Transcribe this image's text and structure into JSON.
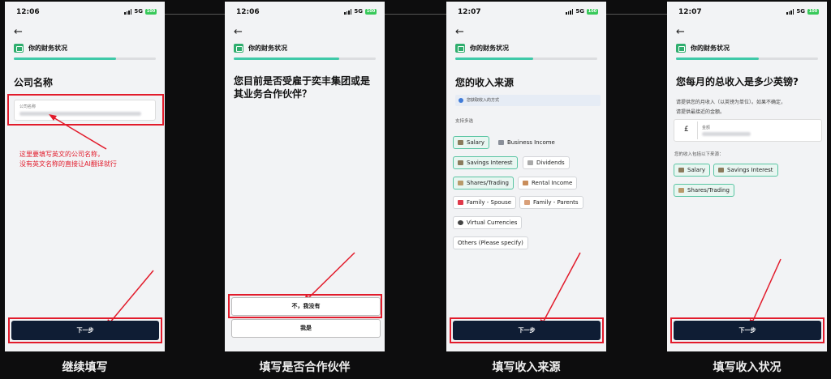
{
  "status_bar": {
    "times": [
      "12:06",
      "12:06",
      "12:07",
      "12:07"
    ],
    "network": "5G",
    "battery": "100"
  },
  "screens": [
    {
      "header": "你的财务状况",
      "question": "公司名称",
      "field_label": "公司名称",
      "annotation": [
        "这里要填写英文的公司名称，",
        "没有英文名称的直接让AI翻译就行"
      ],
      "next_button": "下一步"
    },
    {
      "header": "你的财务状况",
      "question": [
        "您目前是否受雇于奕丰集团或是",
        "其业务合作伙伴？"
      ],
      "options": [
        "不，我没有",
        "我是"
      ]
    },
    {
      "header": "你的财务状况",
      "question": "您的收入来源",
      "info": "您获取收入的方式",
      "multi_hint": "支持多选",
      "sources": [
        {
          "label": "Salary",
          "selected": true,
          "icon": "briefcase-icon"
        },
        {
          "label": "Business Income",
          "selected": false,
          "icon": "building-icon"
        },
        {
          "label": "Savings Interest",
          "selected": true,
          "icon": "bank-icon"
        },
        {
          "label": "Dividends",
          "selected": false,
          "icon": "split-icon"
        },
        {
          "label": "Shares/Trading",
          "selected": true,
          "icon": "chart-icon"
        },
        {
          "label": "Rental Income",
          "selected": false,
          "icon": "house-icon"
        },
        {
          "label": "Family - Spouse",
          "selected": false,
          "icon": "heart-icon"
        },
        {
          "label": "Family - Parents",
          "selected": false,
          "icon": "family-icon"
        },
        {
          "label": "Virtual Currencies",
          "selected": false,
          "icon": "coin-icon"
        },
        {
          "label": "Others (Please specify)",
          "selected": false,
          "icon": ""
        }
      ],
      "next_button": "下一步"
    },
    {
      "header": "你的财务状况",
      "question": "您每月的总收入是多少英镑?",
      "desc": [
        "请提供您的月收入（以英镑为单位）。如果不确定，",
        "请提供最接近的金额。"
      ],
      "currency": "£",
      "amount_label": "金额",
      "includes_label": "您的收入包括以下来源：",
      "chips": [
        "Salary",
        "Savings Interest",
        "Shares/Trading"
      ],
      "next_button": "下一步"
    }
  ],
  "captions": [
    "继续填写",
    "填写是否合作伙伴",
    "填写收入来源",
    "填写收入状况"
  ],
  "colors": {
    "accent": "#3fc9a8",
    "button": "#0f1d34",
    "highlight": "#e21b2b",
    "selected_chip_border": "#59c5a3"
  }
}
